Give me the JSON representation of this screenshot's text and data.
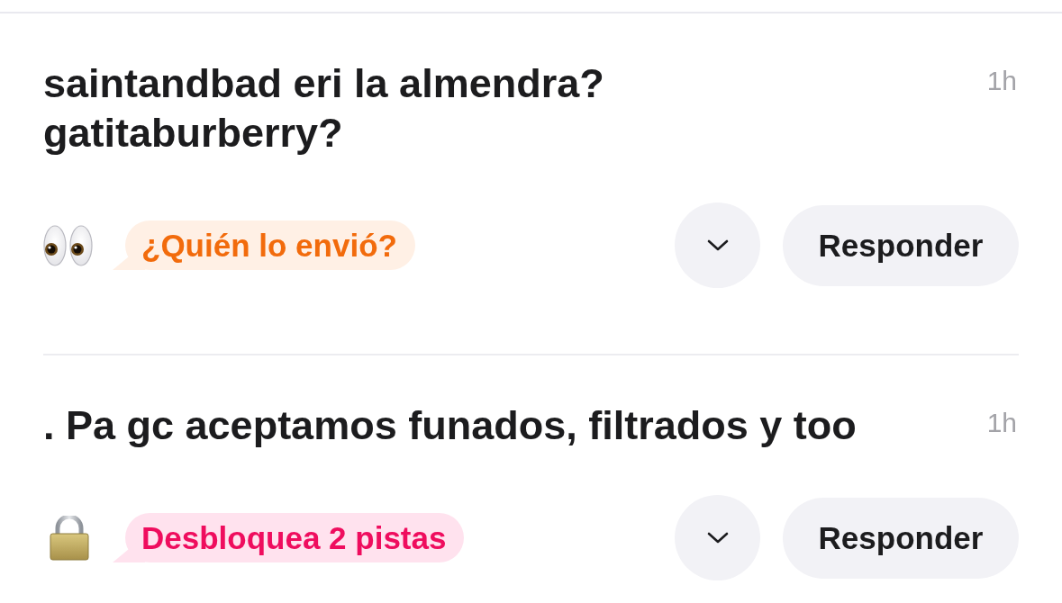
{
  "messages": [
    {
      "text": "saintandbad eri la almendra?\ngatitaburberry?",
      "time": "1h",
      "hint": {
        "kind": "sender",
        "label": "¿Quién lo envió?"
      },
      "reply_button": "Responder"
    },
    {
      "text": ". Pa gc aceptamos funados, filtrados y too",
      "time": "1h",
      "hint": {
        "kind": "locked",
        "label": "Desbloquea 2 pistas"
      },
      "reply_button": "Responder"
    }
  ]
}
